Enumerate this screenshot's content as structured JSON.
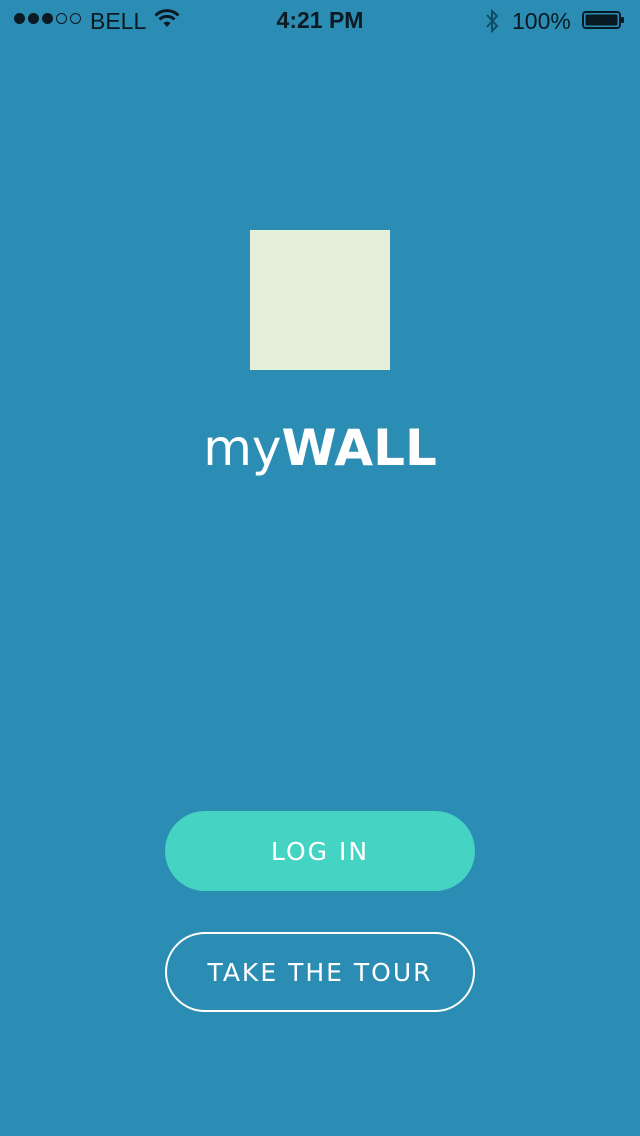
{
  "status_bar": {
    "carrier": "BELL",
    "time": "4:21 PM",
    "battery": "100%",
    "signal_strength": 3,
    "signal_max": 5,
    "icons": [
      "signal-dots-icon",
      "wifi-icon",
      "bluetooth-icon",
      "battery-icon"
    ]
  },
  "brand": {
    "prefix": "my",
    "name": "WALL"
  },
  "actions": {
    "login_label": "LOG IN",
    "tour_label": "TAKE THE TOUR"
  },
  "colors": {
    "background": "#2b8db3",
    "logo": "#e3efd8",
    "login_button": "#45d3c3",
    "text": "#ffffff"
  }
}
